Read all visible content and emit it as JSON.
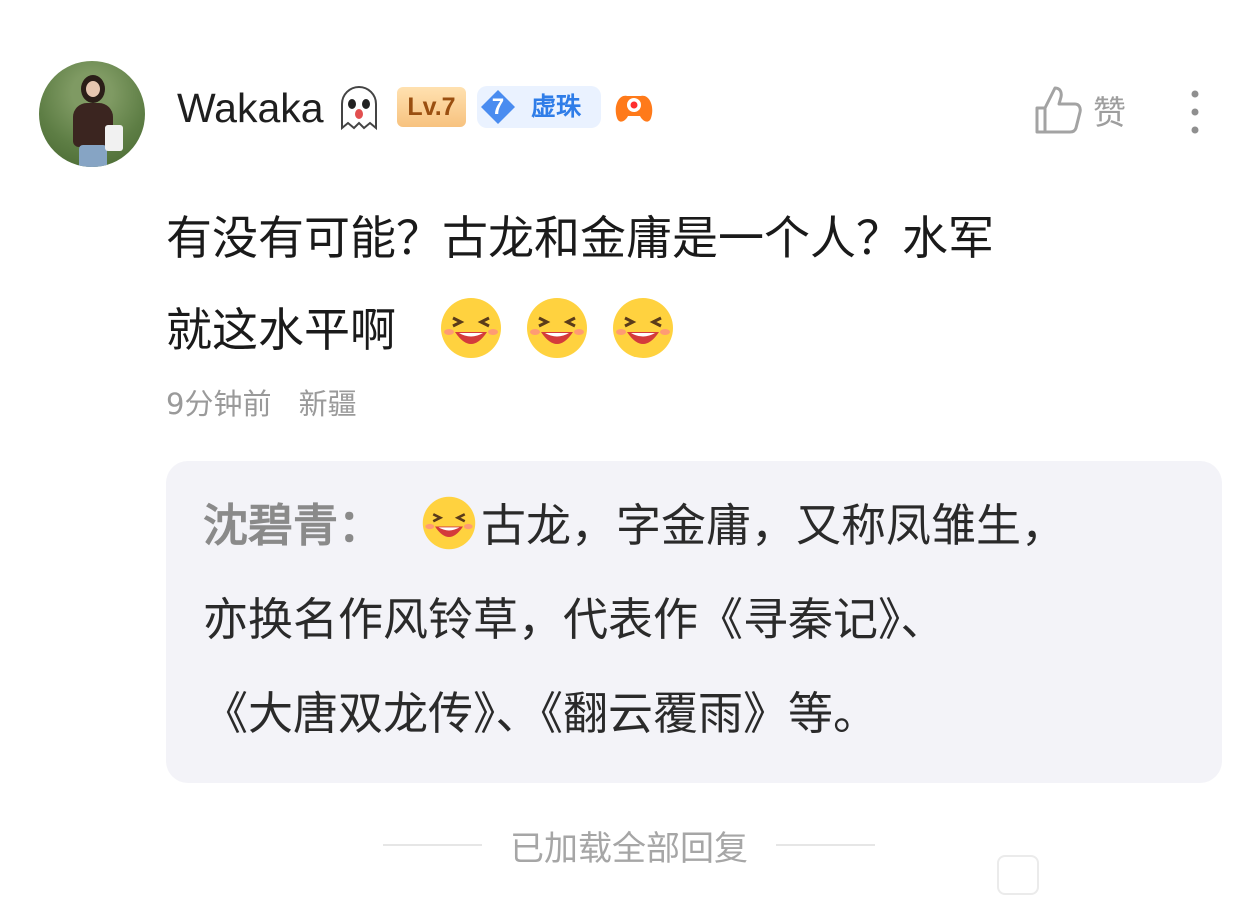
{
  "comment": {
    "username": "Wakaka",
    "level_badge": "Lv.7",
    "vip_level": "7",
    "vip_label": "虚珠",
    "like_label": "赞",
    "text_line1": "有没有可能？古龙和金庸是一个人？水军",
    "text_line2": "就这水平啊",
    "emoji_count": 3,
    "time": "9分钟前",
    "location": "新疆"
  },
  "reply": {
    "author": "沈碧青：",
    "line1": "古龙，字金庸，又称凤雏生，",
    "line2": "亦换名作风铃草，代表作《寻秦记》、",
    "line3": "《大唐双龙传》、《翻云覆雨》等。"
  },
  "footer": {
    "status": "已加载全部回复"
  },
  "colors": {
    "level_badge_bg": "#f7c27f",
    "vip_accent": "#2f7de8",
    "reply_bg": "#f3f3f8",
    "muted_text": "#9a9a9a"
  },
  "icons": [
    "ghost-emoji-icon",
    "diamond-icon",
    "game-controller-icon",
    "thumbs-up-icon",
    "more-vertical-icon",
    "laughing-emoji-icon"
  ]
}
